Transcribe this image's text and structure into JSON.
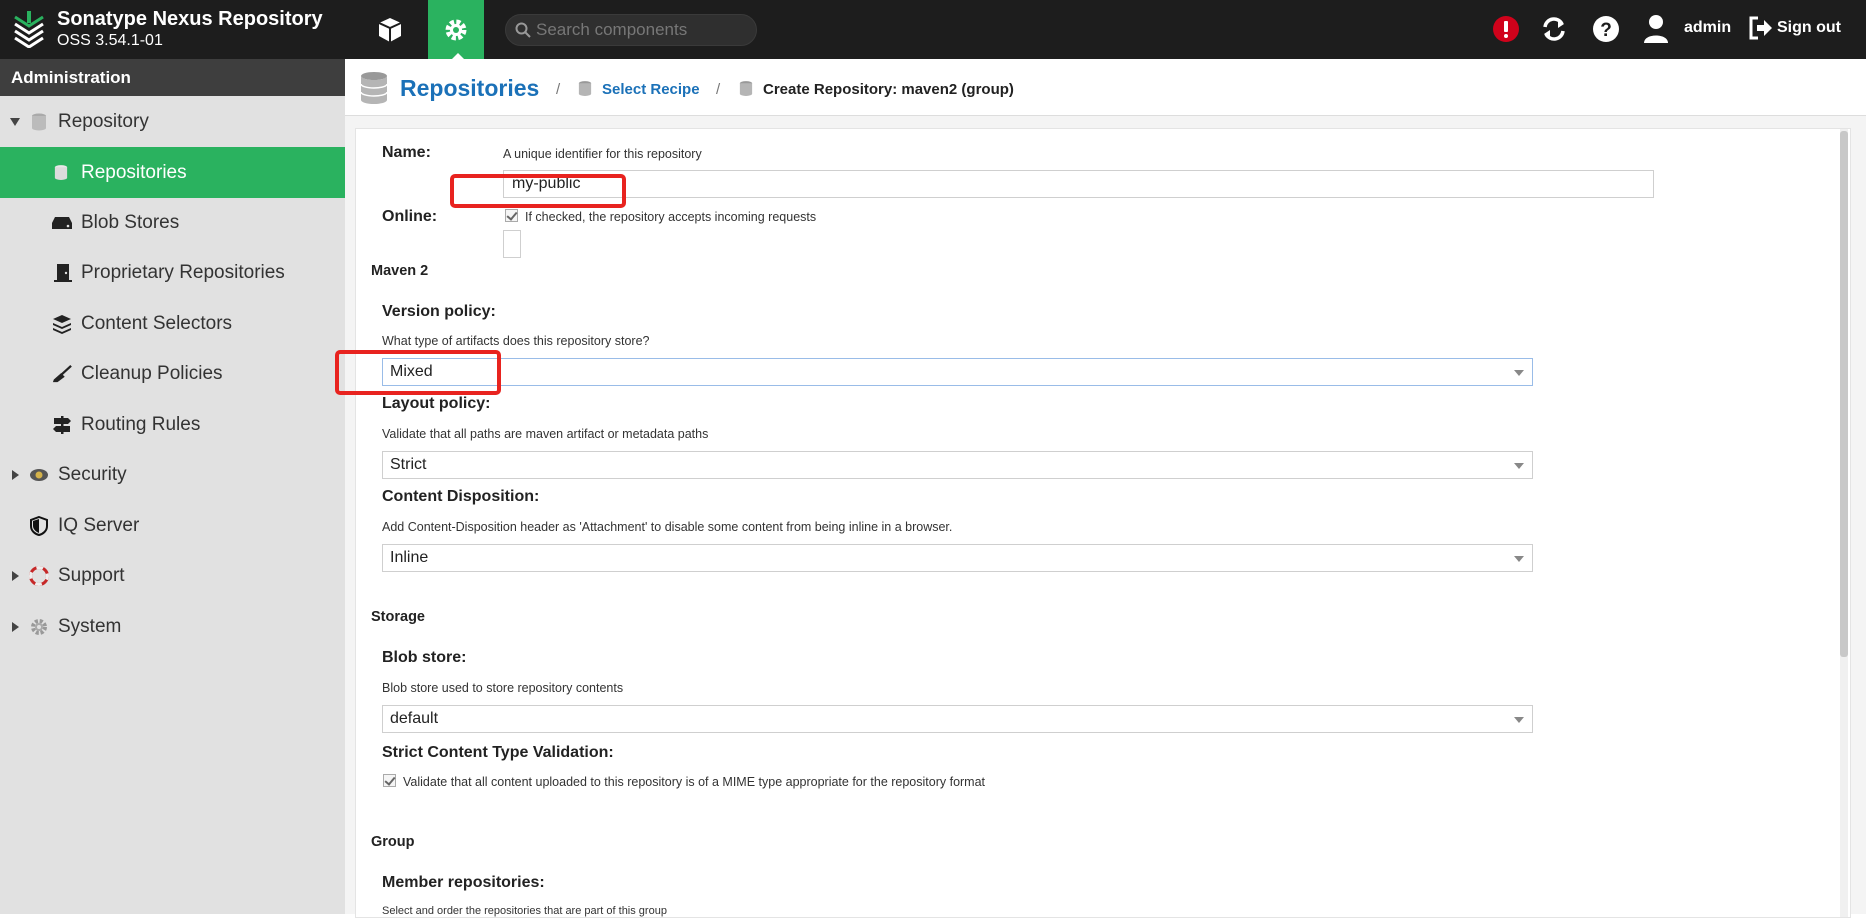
{
  "app": {
    "title": "Sonatype Nexus Repository",
    "version": "OSS 3.54.1-01",
    "search_placeholder": "Search components",
    "user": "admin",
    "sign_out": "Sign out",
    "icons": {
      "logo": "nexus-logo-icon",
      "browse": "cube-icon",
      "admin": "gear-icon",
      "alert": "alert-icon",
      "refresh": "refresh-icon",
      "help": "help-icon",
      "user": "user-icon",
      "signout": "sign-out-icon"
    },
    "colors": {
      "accent": "#2ab25f",
      "link": "#1b71b8",
      "topbar": "#1d1d1d",
      "alert": "#d0021b"
    }
  },
  "sidebar": {
    "header": "Administration",
    "items": [
      {
        "label": "Repository",
        "expanded": true,
        "icon": "database-icon"
      },
      {
        "label": "Repositories",
        "active": true,
        "icon": "database-icon"
      },
      {
        "label": "Blob Stores",
        "icon": "hard-drive-icon"
      },
      {
        "label": "Proprietary Repositories",
        "icon": "door-icon"
      },
      {
        "label": "Content Selectors",
        "icon": "layers-icon"
      },
      {
        "label": "Cleanup Policies",
        "icon": "broom-icon"
      },
      {
        "label": "Routing Rules",
        "icon": "signpost-icon"
      },
      {
        "label": "Security",
        "expanded": false,
        "icon": "badge-icon"
      },
      {
        "label": "IQ Server",
        "icon": "shield-icon"
      },
      {
        "label": "Support",
        "expanded": false,
        "icon": "lifebuoy-icon"
      },
      {
        "label": "System",
        "expanded": false,
        "icon": "gear-icon"
      }
    ]
  },
  "breadcrumb": {
    "title": "Repositories",
    "separator": "/",
    "link": "Select Recipe",
    "current": "Create Repository: maven2 (group)"
  },
  "form": {
    "name": {
      "label": "Name:",
      "help": "A unique identifier for this repository",
      "value": "my-public"
    },
    "online": {
      "label": "Online:",
      "help": "If checked, the repository accepts incoming requests",
      "checked": true
    },
    "maven_section": "Maven 2",
    "version_policy": {
      "label": "Version policy:",
      "help": "What type of artifacts does this repository store?",
      "value": "Mixed"
    },
    "layout_policy": {
      "label": "Layout policy:",
      "help": "Validate that all paths are maven artifact or metadata paths",
      "value": "Strict"
    },
    "content_disposition": {
      "label": "Content Disposition:",
      "help": "Add Content-Disposition header as 'Attachment' to disable some content from being inline in a browser.",
      "value": "Inline"
    },
    "storage_section": "Storage",
    "blob_store": {
      "label": "Blob store:",
      "help": "Blob store used to store repository contents",
      "value": "default"
    },
    "strict_validation": {
      "label": "Strict Content Type Validation:",
      "help": "Validate that all content uploaded to this repository is of a MIME type appropriate for the repository format",
      "checked": true
    },
    "group_section": "Group",
    "members": {
      "label": "Member repositories:",
      "help": "Select and order the repositories that are part of this group"
    }
  }
}
